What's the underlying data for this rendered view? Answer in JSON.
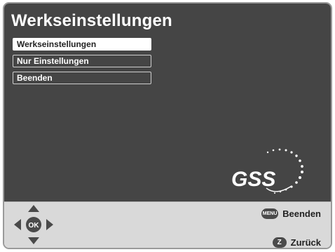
{
  "screen": {
    "title": "Werkseinstellungen",
    "menu": [
      {
        "label": "Werkseinstellungen",
        "selected": true
      },
      {
        "label": "Nur Einstellungen",
        "selected": false
      },
      {
        "label": "Beenden",
        "selected": false
      }
    ]
  },
  "logo": {
    "text": "GSS"
  },
  "footer": {
    "ok_label": "OK",
    "menu_button_label": "MENU",
    "exit_label": "Beenden",
    "back_button_label": "Z",
    "back_label": "Zurück"
  },
  "colors": {
    "background": "#454545",
    "footer": "#d9d9d9",
    "selected": "#ffffff",
    "text": "#ffffff"
  }
}
